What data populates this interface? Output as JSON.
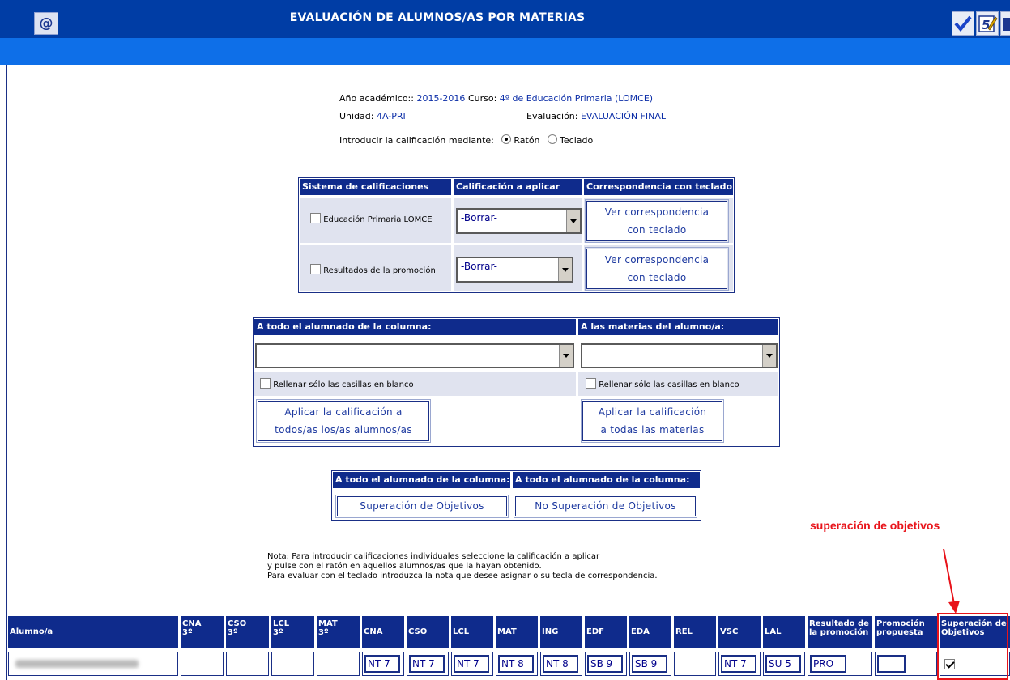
{
  "header": {
    "title": "EVALUACIÓN DE ALUMNOS/AS POR MATERIAS",
    "at_icon": "@",
    "toolbar": [
      {
        "icon": "checkmark-icon"
      },
      {
        "icon": "grade-edit-icon",
        "text": "5"
      },
      {
        "icon": "save-icon"
      }
    ]
  },
  "info": {
    "year_label": "Año académico::",
    "year_value": "2015-2016",
    "course_label": "Curso:",
    "course_value": "4º de Educación Primaria (LOMCE)",
    "unit_label": "Unidad:",
    "unit_value": "4A-PRI",
    "eval_label": "Evaluación:",
    "eval_value": "EVALUACIÓN FINAL",
    "input_mode_label": "Introducir la calificación mediante:",
    "mode_mouse": "Ratón",
    "mode_keyboard": "Teclado",
    "selected_mode": "Ratón"
  },
  "grading": {
    "headers": [
      "Sistema de calificaciones",
      "Calificación a aplicar",
      "Correspondencia con teclado"
    ],
    "rows": [
      {
        "system": "Educación Primaria LOMCE",
        "checked": false,
        "select_value": "-Borrar-",
        "button_line1": "Ver correspondencia",
        "button_line2": "con teclado"
      },
      {
        "system": "Resultados de la promoción",
        "checked": false,
        "select_value": "-Borrar-",
        "button_line1": "Ver correspondencia",
        "button_line2": "con teclado"
      }
    ]
  },
  "apply": {
    "col_header": "A todo el alumnado de la columna:",
    "mat_header": "A las materias del alumno/a:",
    "col_select": "",
    "mat_select": "",
    "fill_blank_label": "Rellenar sólo las casillas en blanco",
    "col_fill_checked": false,
    "mat_fill_checked": false,
    "col_button_line1": "Aplicar la calificación a",
    "col_button_line2": "todos/as los/as alumnos/as",
    "mat_button_line1": "Aplicar la calificación",
    "mat_button_line2": "a todas las materias"
  },
  "objectives": {
    "header_left": "A todo el alumnado de la columna:",
    "header_right": "A todo el alumnado de la columna:",
    "button_left": "Superación de Objetivos",
    "button_right": "No Superación de Objetivos"
  },
  "note": {
    "line1": "Nota: Para introducir calificaciones individuales seleccione la calificación a aplicar",
    "line2": "y pulse con el ratón en aquellos alumnos/as que la hayan obtenido.",
    "line3": "Para evaluar con el teclado introduzca la nota que desee asignar o su tecla de correspondencia."
  },
  "annotation": "superación de objetivos",
  "grid": {
    "student_header": "Alumno/a",
    "columns": [
      {
        "l1": "CNA",
        "l2": "3º",
        "value": "",
        "input": false
      },
      {
        "l1": "CSO",
        "l2": "3º",
        "value": "",
        "input": false
      },
      {
        "l1": "LCL",
        "l2": "3º",
        "value": "",
        "input": false
      },
      {
        "l1": "MAT",
        "l2": "3º",
        "value": "",
        "input": false
      },
      {
        "l1": "CNA",
        "l2": "",
        "value": "NT 7",
        "input": true
      },
      {
        "l1": "CSO",
        "l2": "",
        "value": "NT 7",
        "input": true
      },
      {
        "l1": "LCL",
        "l2": "",
        "value": "NT 7",
        "input": true
      },
      {
        "l1": "MAT",
        "l2": "",
        "value": "NT 8",
        "input": true
      },
      {
        "l1": "ING",
        "l2": "",
        "value": "NT 8",
        "input": true
      },
      {
        "l1": "EDF",
        "l2": "",
        "value": "SB 9",
        "input": true
      },
      {
        "l1": "EDA",
        "l2": "",
        "value": "SB 9",
        "input": true
      },
      {
        "l1": "REL",
        "l2": "",
        "value": "",
        "input": false
      },
      {
        "l1": "VSC",
        "l2": "",
        "value": "NT 7",
        "input": true
      },
      {
        "l1": "LAL",
        "l2": "",
        "value": "SU 5",
        "input": true
      },
      {
        "l1": "Resultado de",
        "l2": "la promoción",
        "value": "PRO",
        "input": true
      },
      {
        "l1": "Promoción",
        "l2": "propuesta",
        "value": "",
        "input": true
      },
      {
        "l1": "Superación de",
        "l2": "Objetivos",
        "value": "",
        "input": false,
        "checkbox": true,
        "checked": true
      }
    ]
  }
}
